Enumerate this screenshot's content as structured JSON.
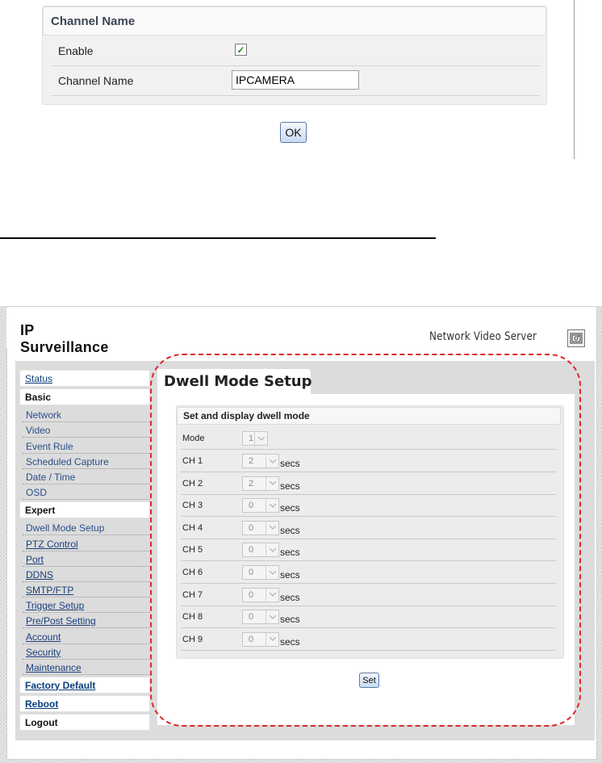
{
  "top_panel": {
    "header": "Channel Name",
    "enable_label": "Enable",
    "enable_checked": true,
    "channel_name_label": "Channel Name",
    "channel_name_value": "IPCAMERA",
    "ok_label": "OK"
  },
  "app": {
    "title": "IP Surveillance",
    "product": "Network Video Server"
  },
  "sidebar": {
    "status": "Status",
    "basic": "Basic",
    "basic_items": [
      "Network",
      "Video",
      "Event Rule",
      "Scheduled Capture",
      "Date / Time",
      "OSD"
    ],
    "expert": "Expert",
    "expert_items": [
      "Dwell Mode Setup",
      "PTZ Control",
      "Port",
      "DDNS",
      "SMTP/FTP",
      "Trigger Setup",
      "Pre/Post Setting",
      "Account",
      "Security",
      "Maintenance"
    ],
    "factory_default": "Factory Default",
    "reboot": "Reboot",
    "logout": "Logout"
  },
  "content": {
    "title": "Dwell Mode Setup",
    "section_header": "Set and display dwell mode",
    "mode_label": "Mode",
    "mode_value": "1",
    "unit": "secs",
    "channels": [
      {
        "label": "CH 1",
        "value": "2"
      },
      {
        "label": "CH 2",
        "value": "2"
      },
      {
        "label": "CH 3",
        "value": "0"
      },
      {
        "label": "CH 4",
        "value": "0"
      },
      {
        "label": "CH 5",
        "value": "0"
      },
      {
        "label": "CH 6",
        "value": "0"
      },
      {
        "label": "CH 7",
        "value": "0"
      },
      {
        "label": "CH 8",
        "value": "0"
      },
      {
        "label": "CH 9",
        "value": "0"
      }
    ],
    "set_label": "Set"
  },
  "colors": {
    "highlight_outline": "#e0262a",
    "link": "#1b3f7c"
  }
}
